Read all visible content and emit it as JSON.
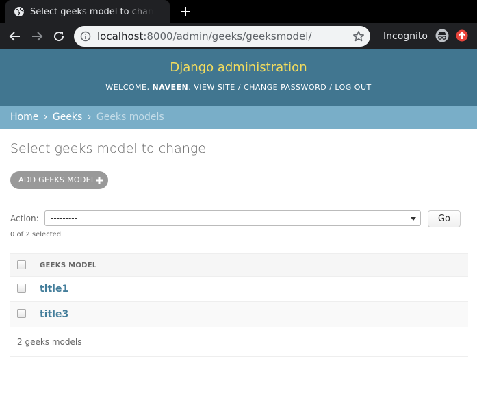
{
  "browser": {
    "tab_title": "Select geeks model to change | Django site admin",
    "url_host": "localhost",
    "url_rest": ":8000/admin/geeks/geeksmodel/",
    "incognito_label": "Incognito",
    "icons": [
      "globe-icon",
      "plus-icon",
      "back-arrow-icon",
      "forward-arrow-icon",
      "reload-icon",
      "info-icon",
      "star-icon",
      "incognito-icon",
      "update-icon"
    ]
  },
  "header": {
    "branding": "Django administration",
    "welcome": "WELCOME, ",
    "username": "NAVEEN",
    "period": ". ",
    "view_site": "VIEW SITE",
    "separator": " / ",
    "change_password": "CHANGE PASSWORD",
    "log_out": "LOG OUT"
  },
  "breadcrumbs": {
    "home": "Home",
    "app": "Geeks",
    "current": "Geeks models",
    "separator": "›"
  },
  "content": {
    "title": "Select geeks model to change",
    "add_button": "ADD GEEKS MODEL",
    "action_label": "Action:",
    "action_selected": "---------",
    "go_button": "Go",
    "selected_count": "0 of 2 selected",
    "column_header": "GEEKS MODEL",
    "rows": [
      {
        "label": "title1"
      },
      {
        "label": "title3"
      }
    ],
    "paginator": "2 geeks models"
  },
  "colors": {
    "header_bg": "#417690",
    "branding": "#f5dd5d",
    "breadcrumbs_bg": "#79aec8",
    "link": "#447e9b",
    "add_button_bg": "#999999"
  }
}
